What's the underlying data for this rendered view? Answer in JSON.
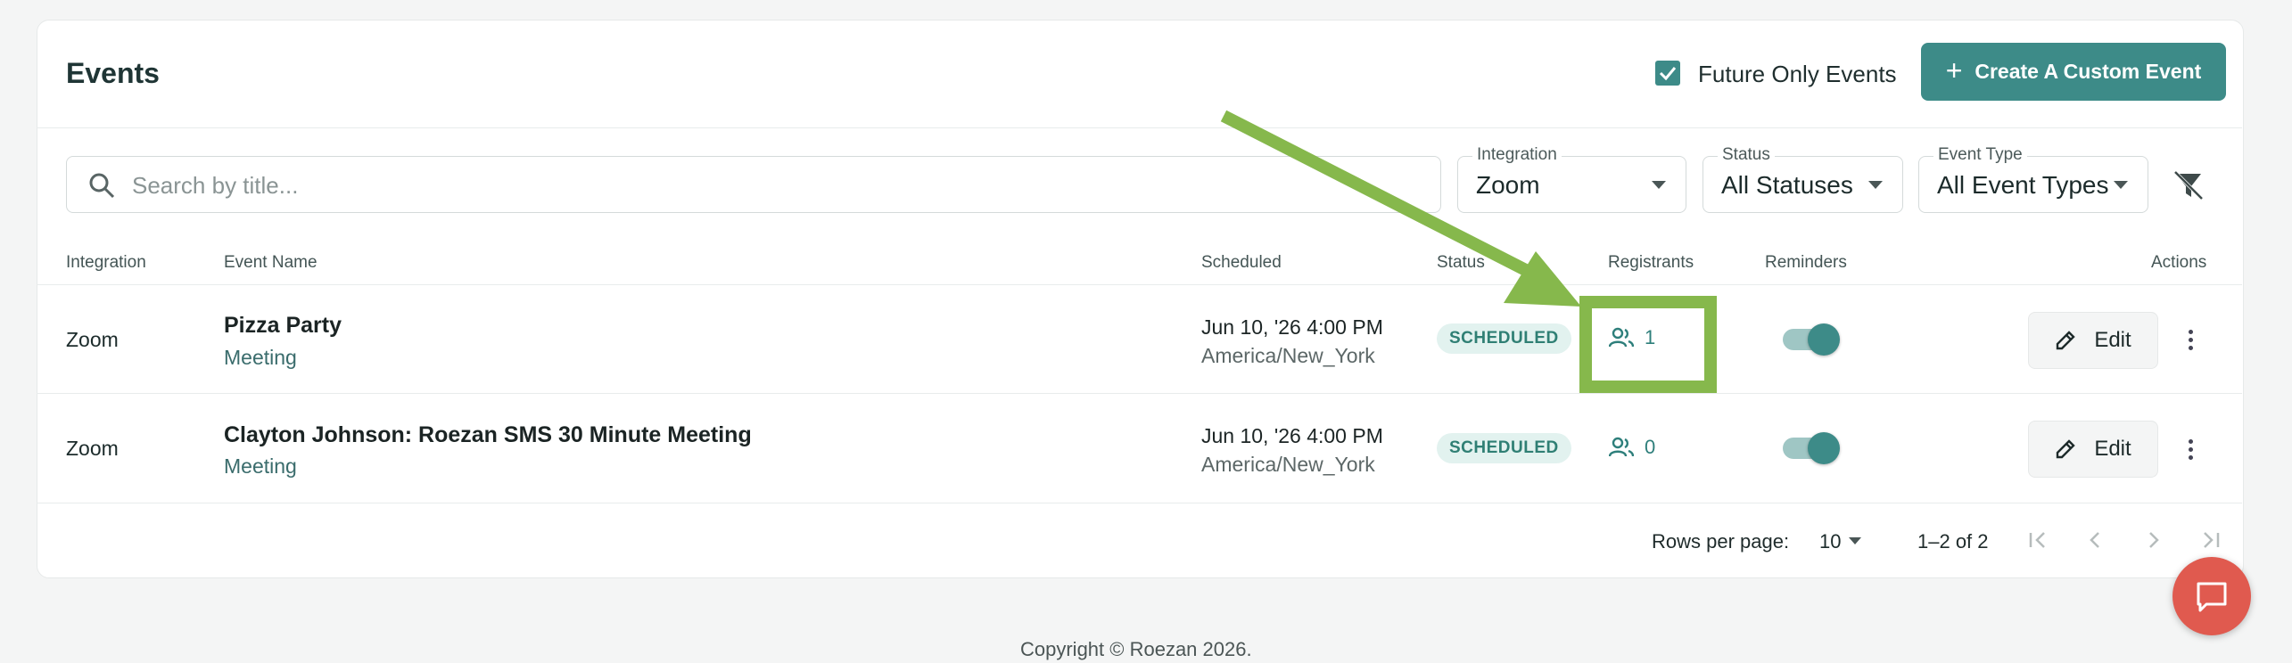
{
  "header": {
    "title": "Events",
    "future_only_label": "Future Only Events",
    "future_only_checked": true,
    "create_button_label": "Create A Custom Event"
  },
  "filters": {
    "search_placeholder": "Search by title...",
    "integration": {
      "label": "Integration",
      "value": "Zoom"
    },
    "status": {
      "label": "Status",
      "value": "All Statuses"
    },
    "event_type": {
      "label": "Event Type",
      "value": "All Event Types"
    }
  },
  "table": {
    "columns": {
      "integration": "Integration",
      "event_name": "Event Name",
      "scheduled": "Scheduled",
      "status": "Status",
      "registrants": "Registrants",
      "reminders": "Reminders",
      "actions": "Actions"
    },
    "rows": [
      {
        "integration": "Zoom",
        "name": "Pizza Party",
        "type": "Meeting",
        "scheduled": "Jun 10, '26 4:00 PM",
        "timezone": "America/New_York",
        "status": "SCHEDULED",
        "registrants": "1",
        "reminders_on": true,
        "edit_label": "Edit"
      },
      {
        "integration": "Zoom",
        "name": "Clayton Johnson: Roezan SMS 30 Minute Meeting",
        "type": "Meeting",
        "scheduled": "Jun 10, '26 4:00 PM",
        "timezone": "America/New_York",
        "status": "SCHEDULED",
        "registrants": "0",
        "reminders_on": true,
        "edit_label": "Edit"
      }
    ]
  },
  "pagination": {
    "rows_per_page_label": "Rows per page:",
    "rows_per_page": "10",
    "range": "1–2 of 2"
  },
  "footer": {
    "copyright": "Copyright © Roezan 2026."
  },
  "colors": {
    "accent": "#3d8b88",
    "badge_bg": "#e2f2ef",
    "annotation_green": "#86b84c",
    "chat_button": "#e05a4f"
  }
}
